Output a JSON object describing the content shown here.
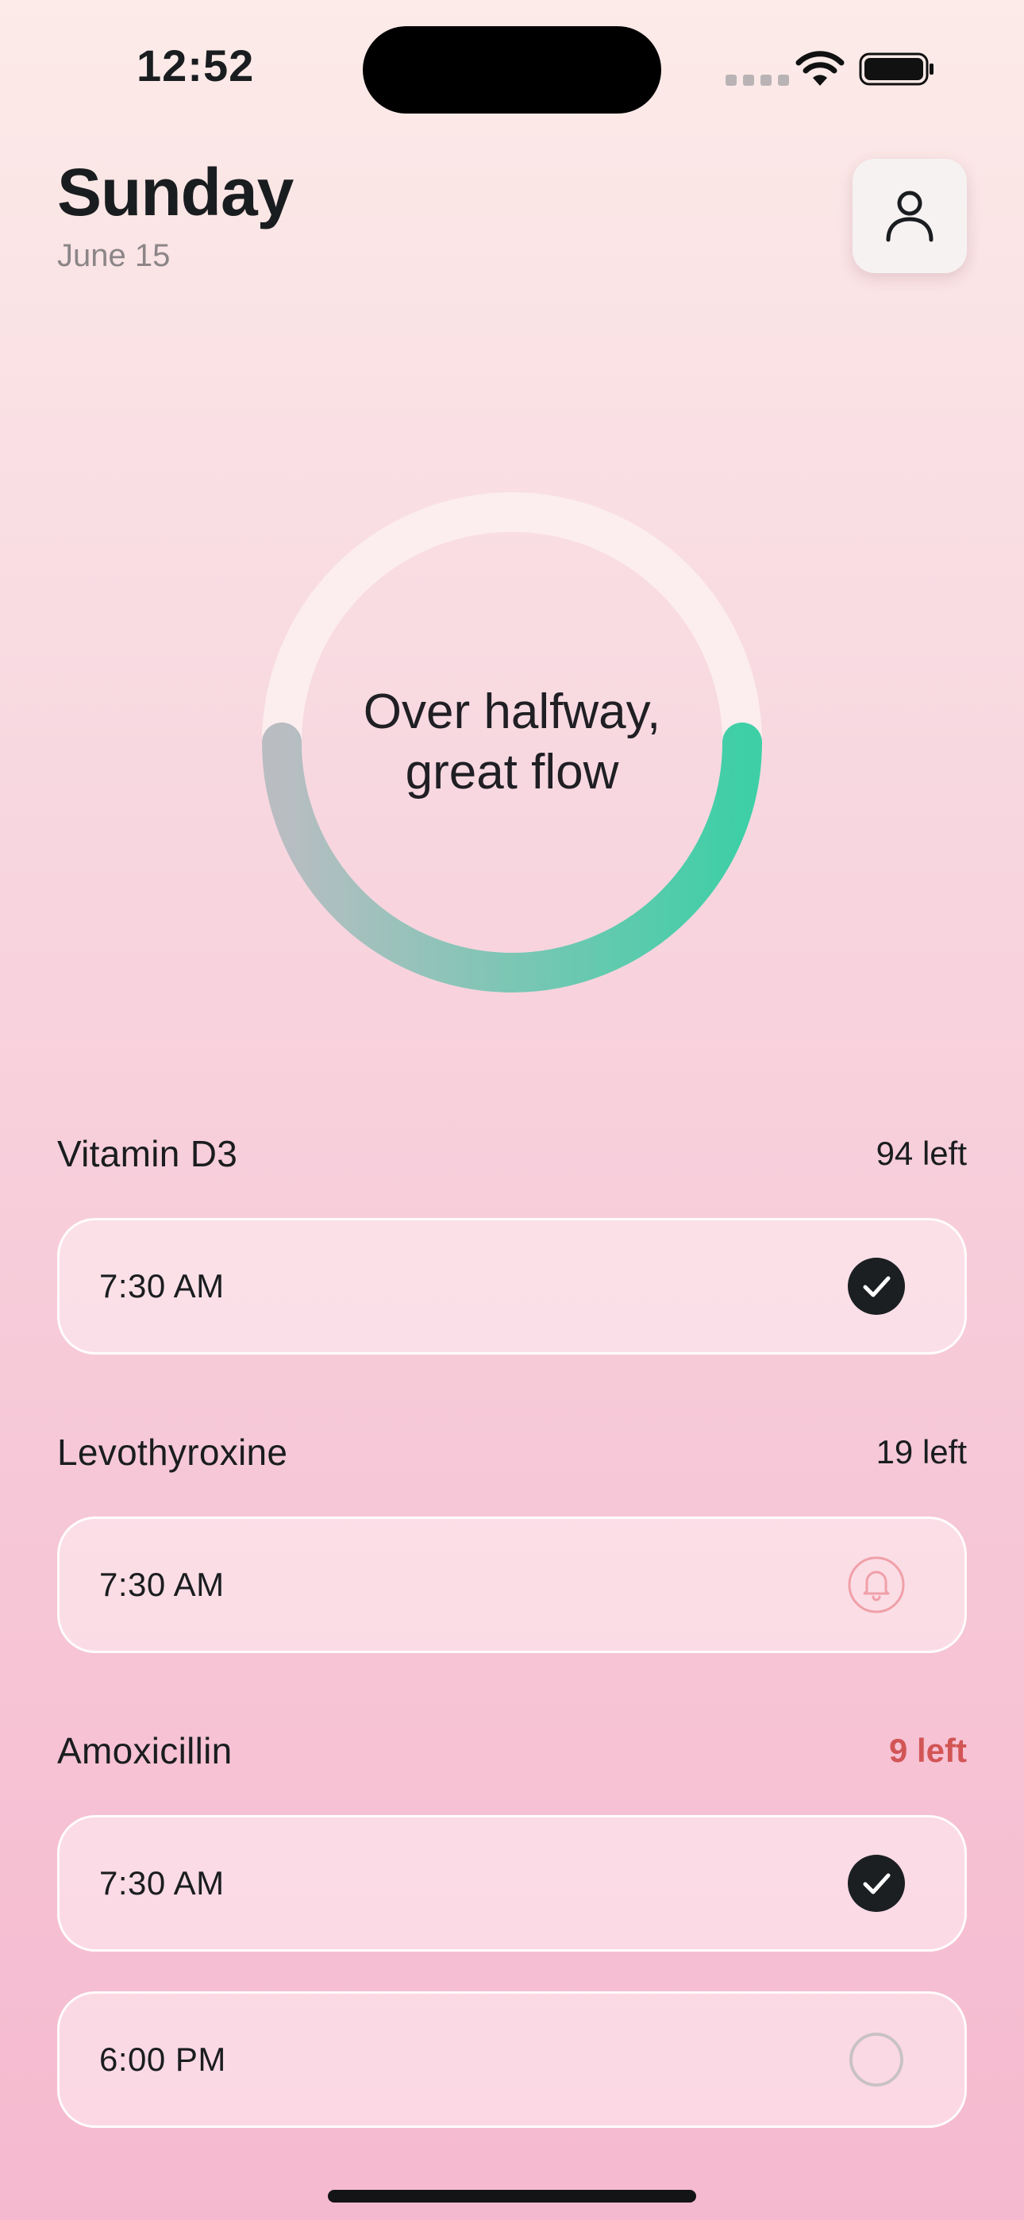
{
  "status_bar": {
    "time": "12:52"
  },
  "header": {
    "day": "Sunday",
    "date": "June 15",
    "profile_icon": "person-icon"
  },
  "progress": {
    "message_line1": "Over halfway,",
    "message_line2": "great flow",
    "fraction_complete": 0.5,
    "colors": {
      "track": "#fcedee",
      "start": "#b9bdc2",
      "end": "#3ecfa6"
    }
  },
  "medications": [
    {
      "name": "Vitamin D3",
      "remaining": "94 left",
      "low": false,
      "doses": [
        {
          "time": "7:30 AM",
          "status": "taken",
          "icon": "check-circle-icon"
        }
      ]
    },
    {
      "name": "Levothyroxine",
      "remaining": "19 left",
      "low": false,
      "doses": [
        {
          "time": "7:30 AM",
          "status": "reminder",
          "icon": "bell-icon"
        }
      ]
    },
    {
      "name": "Amoxicillin",
      "remaining": "9 left",
      "low": true,
      "doses": [
        {
          "time": "7:30 AM",
          "status": "taken",
          "icon": "check-circle-icon"
        },
        {
          "time": "6:00 PM",
          "status": "pending",
          "icon": "empty-circle-icon"
        }
      ]
    }
  ],
  "colors": {
    "low_stock": "#d25555",
    "check_fill": "#1b1f22",
    "bell_stroke": "#f0a0a8",
    "pending_stroke": "#c9c2c5"
  }
}
